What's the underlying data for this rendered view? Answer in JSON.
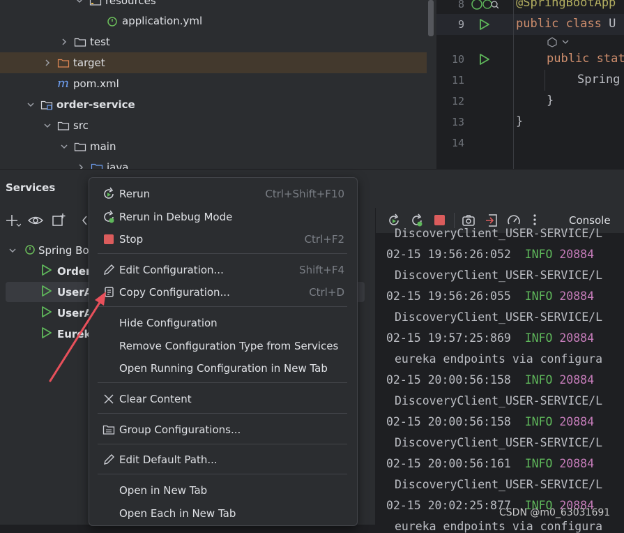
{
  "project_tree": {
    "rows": [
      {
        "label": "resources",
        "kind": "folder-resources"
      },
      {
        "label": "application.yml",
        "kind": "yml"
      },
      {
        "label": "test",
        "kind": "folder"
      },
      {
        "label": "target",
        "kind": "folder-target"
      },
      {
        "label": "pom.xml",
        "kind": "maven"
      },
      {
        "label": "order-service",
        "kind": "module"
      },
      {
        "label": "src",
        "kind": "folder"
      },
      {
        "label": "main",
        "kind": "folder"
      },
      {
        "label": "java",
        "kind": "folder-java"
      }
    ]
  },
  "editor": {
    "line_numbers": [
      "8",
      "9",
      "10",
      "11",
      "12",
      "13",
      "14"
    ],
    "lines": {
      "l8": "@SpringBootApp",
      "l9_kw1": "public ",
      "l9_kw2": "class ",
      "l9_name": "U",
      "l10_kw": "public ",
      "l10_kw2": "stat",
      "l11": "Spring",
      "l12": "}",
      "l13": "}"
    }
  },
  "services": {
    "title": "Services",
    "tree": [
      {
        "label": "Spring Bo"
      },
      {
        "label": "Order"
      },
      {
        "label": "UserA"
      },
      {
        "label": "UserA"
      },
      {
        "label": "Eurek"
      }
    ]
  },
  "console": {
    "tab_label": "Console",
    "lines": [
      {
        "text": "DiscoveryClient_USER-SERVICE/L"
      },
      {
        "ts": "02-15 19:56:26:052",
        "level": "INFO",
        "pid": "20884"
      },
      {
        "text": "DiscoveryClient_USER-SERVICE/L"
      },
      {
        "ts": "02-15 19:56:26:055",
        "level": "INFO",
        "pid": "20884"
      },
      {
        "text": "DiscoveryClient_USER-SERVICE/L"
      },
      {
        "ts": "02-15 19:57:25:869",
        "level": "INFO",
        "pid": "20884"
      },
      {
        "text": "eureka endpoints via configura"
      },
      {
        "ts": "02-15 20:00:56:158",
        "level": "INFO",
        "pid": "20884"
      },
      {
        "text": "DiscoveryClient_USER-SERVICE/L"
      },
      {
        "ts": "02-15 20:00:56:158",
        "level": "INFO",
        "pid": "20884"
      },
      {
        "text": "DiscoveryClient_USER-SERVICE/L"
      },
      {
        "ts": "02-15 20:00:56:161",
        "level": "INFO",
        "pid": "20884"
      },
      {
        "text": "DiscoveryClient_USER-SERVICE/L"
      },
      {
        "ts": "02-15 20:02:25:877",
        "level": "INFO",
        "pid": "20884"
      },
      {
        "text": "eureka endpoints via configura"
      }
    ]
  },
  "context_menu": {
    "items": [
      {
        "label": "Rerun",
        "shortcut": "Ctrl+Shift+F10",
        "icon": "rerun-icon"
      },
      {
        "label": "Rerun in Debug Mode",
        "shortcut": "",
        "icon": "rerun-debug-icon"
      },
      {
        "label": "Stop",
        "shortcut": "Ctrl+F2",
        "icon": "stop-icon"
      },
      {
        "label": "Edit Configuration...",
        "shortcut": "Shift+F4",
        "icon": "pencil-icon"
      },
      {
        "label": "Copy Configuration...",
        "shortcut": "Ctrl+D",
        "icon": "copy-icon"
      },
      {
        "label": "Hide Configuration",
        "shortcut": "",
        "icon": ""
      },
      {
        "label": "Remove Configuration Type from Services",
        "shortcut": "",
        "icon": ""
      },
      {
        "label": "Open Running Configuration in New Tab",
        "shortcut": "",
        "icon": ""
      },
      {
        "label": "Clear Content",
        "shortcut": "",
        "icon": "close-icon"
      },
      {
        "label": "Group Configurations...",
        "shortcut": "",
        "icon": "group-icon"
      },
      {
        "label": "Edit Default Path...",
        "shortcut": "",
        "icon": "pencil-icon"
      },
      {
        "label": "Open in New Tab",
        "shortcut": "",
        "icon": ""
      },
      {
        "label": "Open Each in New Tab",
        "shortcut": "",
        "icon": ""
      }
    ]
  },
  "watermark": "CSDN @m0_63031691",
  "colors": {
    "accent_stop": "#db5c5c",
    "run_green": "#5fb85b",
    "arrow_red": "#e8505b"
  }
}
